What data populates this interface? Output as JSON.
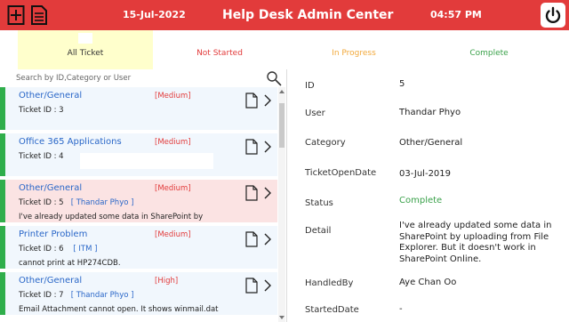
{
  "header": {
    "date": "15-Jul-2022",
    "title": "Help Desk Admin Center",
    "time": "04:57 PM",
    "brand_color": "#e23b3b"
  },
  "tabs": [
    {
      "label": "All Ticket",
      "color": "#333333"
    },
    {
      "label": "Not Started",
      "color": "#e23b3b"
    },
    {
      "label": "In Progress",
      "color": "#f2a93b"
    },
    {
      "label": "Complete",
      "color": "#3aa14a"
    }
  ],
  "search": {
    "placeholder": "Search by ID,Category or User"
  },
  "tickets": [
    {
      "category": "Other/General",
      "priority": "[Medium]",
      "ticket_id": "Ticket ID : 3",
      "assignee": "",
      "detail": ""
    },
    {
      "category": "Office 365 Applications",
      "priority": "[Medium]",
      "ticket_id": "Ticket ID : 4",
      "assignee": "",
      "detail": ""
    },
    {
      "category": "Other/General",
      "priority": "[Medium]",
      "ticket_id": "Ticket ID : 5",
      "assignee": "[ Thandar Phyo ]",
      "detail": "I've already updated some data in SharePoint by"
    },
    {
      "category": "Printer Problem",
      "priority": "[Medium]",
      "ticket_id": "Ticket ID : 6",
      "assignee": "[ ITM ]",
      "detail": "cannot print at HP274CDB."
    },
    {
      "category": "Other/General",
      "priority": "[High]",
      "ticket_id": "Ticket ID : 7",
      "assignee": "[ Thandar Phyo ]",
      "detail": "Email Attachment cannot open. It shows winmail.dat"
    }
  ],
  "detail": {
    "id": {
      "label": "ID",
      "value": "5"
    },
    "user": {
      "label": "User",
      "value": "Thandar Phyo"
    },
    "category": {
      "label": "Category",
      "value": "Other/General"
    },
    "open_date": {
      "label": "TicketOpenDate",
      "value": "03-Jul-2019"
    },
    "status": {
      "label": "Status",
      "value": "Complete"
    },
    "detail": {
      "label": "Detail",
      "value": "I've already updated some data in SharePoint by uploading from File Explorer. But it doesn't work in SharePoint Online."
    },
    "handled_by": {
      "label": "HandledBy",
      "value": "Aye Chan Oo"
    },
    "started_date": {
      "label": "StartedDate",
      "value": "-"
    }
  }
}
